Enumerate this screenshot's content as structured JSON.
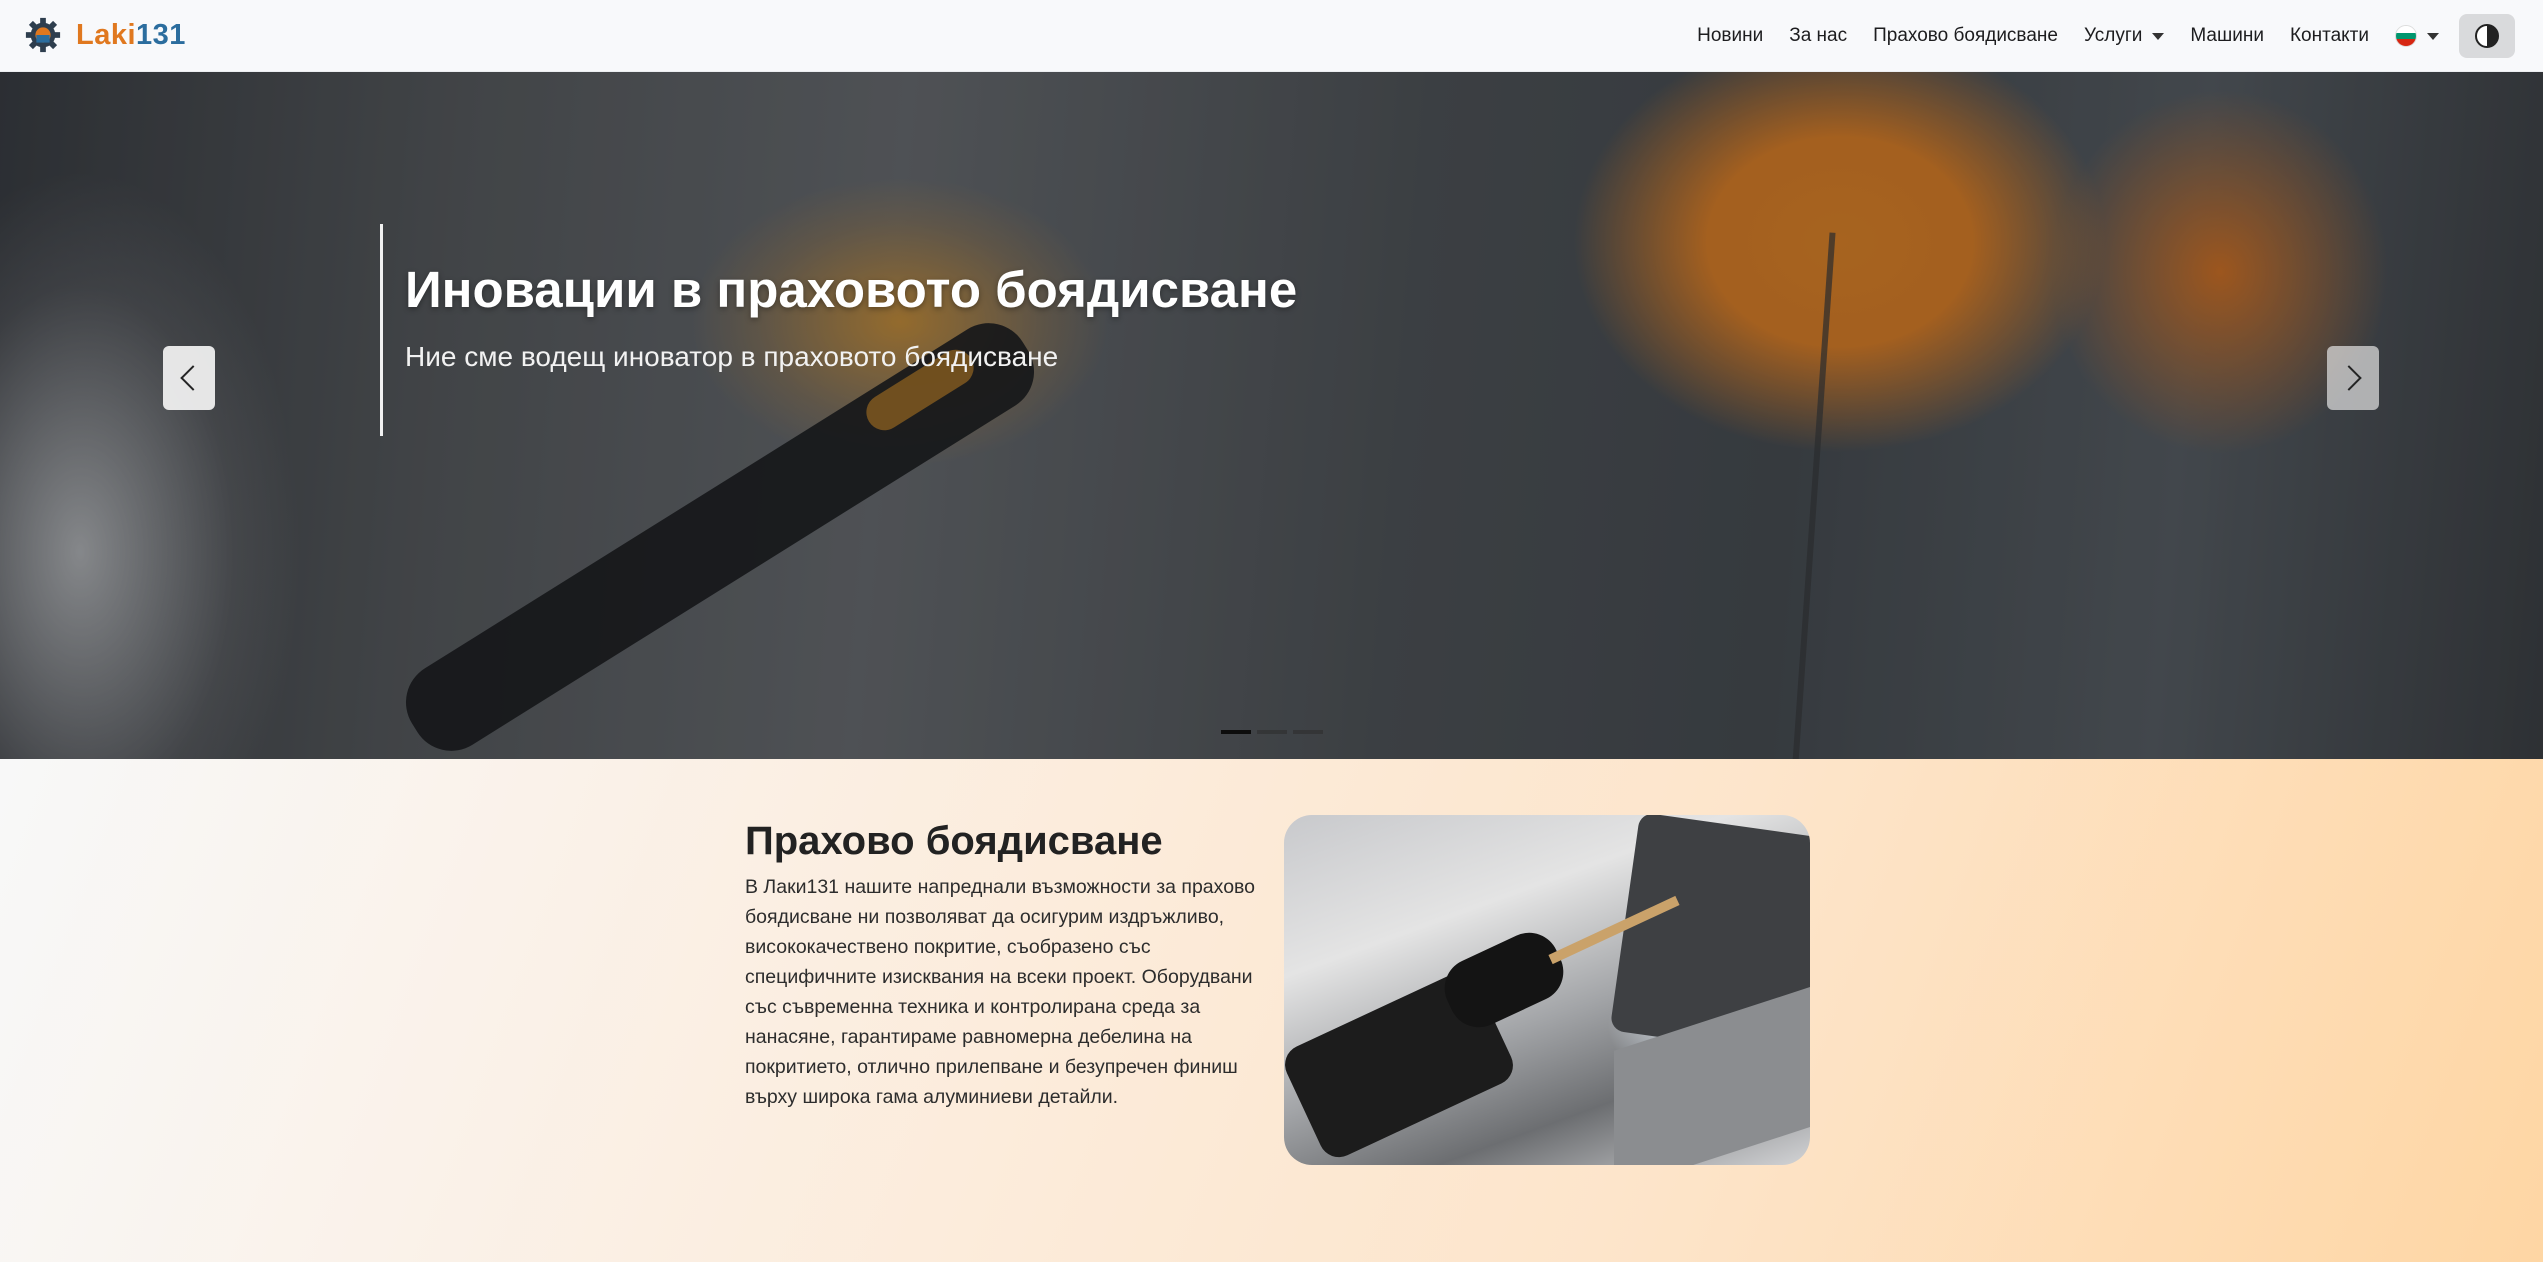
{
  "brand": {
    "part1": "Laki",
    "part2": "131"
  },
  "nav": {
    "items": [
      "Новини",
      "За нас",
      "Прахово боядисване",
      "Услуги",
      "Машини",
      "Контакти"
    ],
    "language": "bg"
  },
  "hero": {
    "title": "Иновации в праховото боядисване",
    "subtitle": "Ние сме водещ иноватор в праховото боядисване",
    "slide_count": 3,
    "active_slide": 1
  },
  "section": {
    "title": "Прахово боядисване",
    "text": "В Лаки131 нашите напреднали възможности за прахово боядисване ни позволяват да осигурим издръжливо, висококачествено покритие, съобразено със специфичните изисквания на всеки проект. Оборудвани със съвременна техника и контролирана среда за нанасяне, гарантираме равномерна дебелина на покритието, отлично прилепване и безупречен финиш върху широка гама алуминиеви детайли."
  },
  "colors": {
    "brand_orange": "#e0781f",
    "brand_blue": "#2b6d9e"
  },
  "icons": [
    "gear-logo-icon",
    "caret-down-icon",
    "bulgaria-flag-icon",
    "contrast-icon",
    "chevron-left-icon",
    "chevron-right-icon"
  ]
}
